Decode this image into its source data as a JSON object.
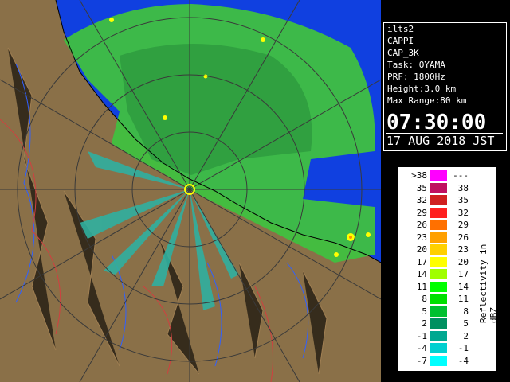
{
  "info": {
    "site": "ilts2",
    "product": "CAPPI",
    "product_code": "CAP_3K",
    "task": "Task: OYAMA",
    "prf": "PRF: 1800Hz",
    "height": "Height:3.0 km",
    "max_range": "Max Range:80 km",
    "time": "07:30:00",
    "date": "17 AUG 2018 JST"
  },
  "legend": {
    "unit": "Reflectivity in dBZ",
    "rows": [
      {
        "lo": ">38",
        "hi": "---",
        "color": "#ff00ff"
      },
      {
        "lo": "35",
        "hi": "38",
        "color": "#c01060"
      },
      {
        "lo": "32",
        "hi": "35",
        "color": "#d02020"
      },
      {
        "lo": "29",
        "hi": "32",
        "color": "#ff2020"
      },
      {
        "lo": "26",
        "hi": "29",
        "color": "#ff7000"
      },
      {
        "lo": "23",
        "hi": "26",
        "color": "#ffa000"
      },
      {
        "lo": "20",
        "hi": "23",
        "color": "#ffd000"
      },
      {
        "lo": "17",
        "hi": "20",
        "color": "#ffff00"
      },
      {
        "lo": "14",
        "hi": "17",
        "color": "#a0ff00"
      },
      {
        "lo": "11",
        "hi": "14",
        "color": "#00ff00"
      },
      {
        "lo": "8",
        "hi": "11",
        "color": "#00e000"
      },
      {
        "lo": "5",
        "hi": "8",
        "color": "#00c030"
      },
      {
        "lo": "2",
        "hi": "5",
        "color": "#009060"
      },
      {
        "lo": "-1",
        "hi": "2",
        "color": "#00a890"
      },
      {
        "lo": "-4",
        "hi": "-1",
        "color": "#00d0d0"
      },
      {
        "lo": "-7",
        "hi": "-4",
        "color": "#00ffff"
      }
    ]
  },
  "colors": {
    "sea": "#1040e0",
    "land": "#8a7048",
    "echo": "#40c040",
    "range_ring": "#3a3a3a",
    "radar_site": "#ffff00"
  }
}
